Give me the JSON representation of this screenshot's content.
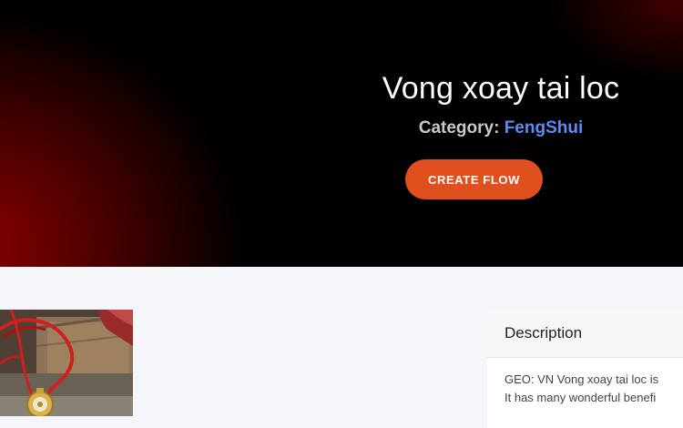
{
  "hero": {
    "title": "Vong xoay tai loc",
    "category_label": "Category:",
    "category_value": "FengShui",
    "create_flow_label": "CREATE FLOW"
  },
  "description": {
    "header": "Description",
    "line1": "GEO: VN Vong xoay tai loc is",
    "line2": "It has many wonderful benefi"
  },
  "colors": {
    "accent_button": "#e0501e",
    "category_link": "#5b8cf5",
    "hero_background": "#000000",
    "hero_glow": "#8a0000"
  },
  "icons": {
    "product_image": "red-string-bracelet-with-gold-pendant"
  }
}
